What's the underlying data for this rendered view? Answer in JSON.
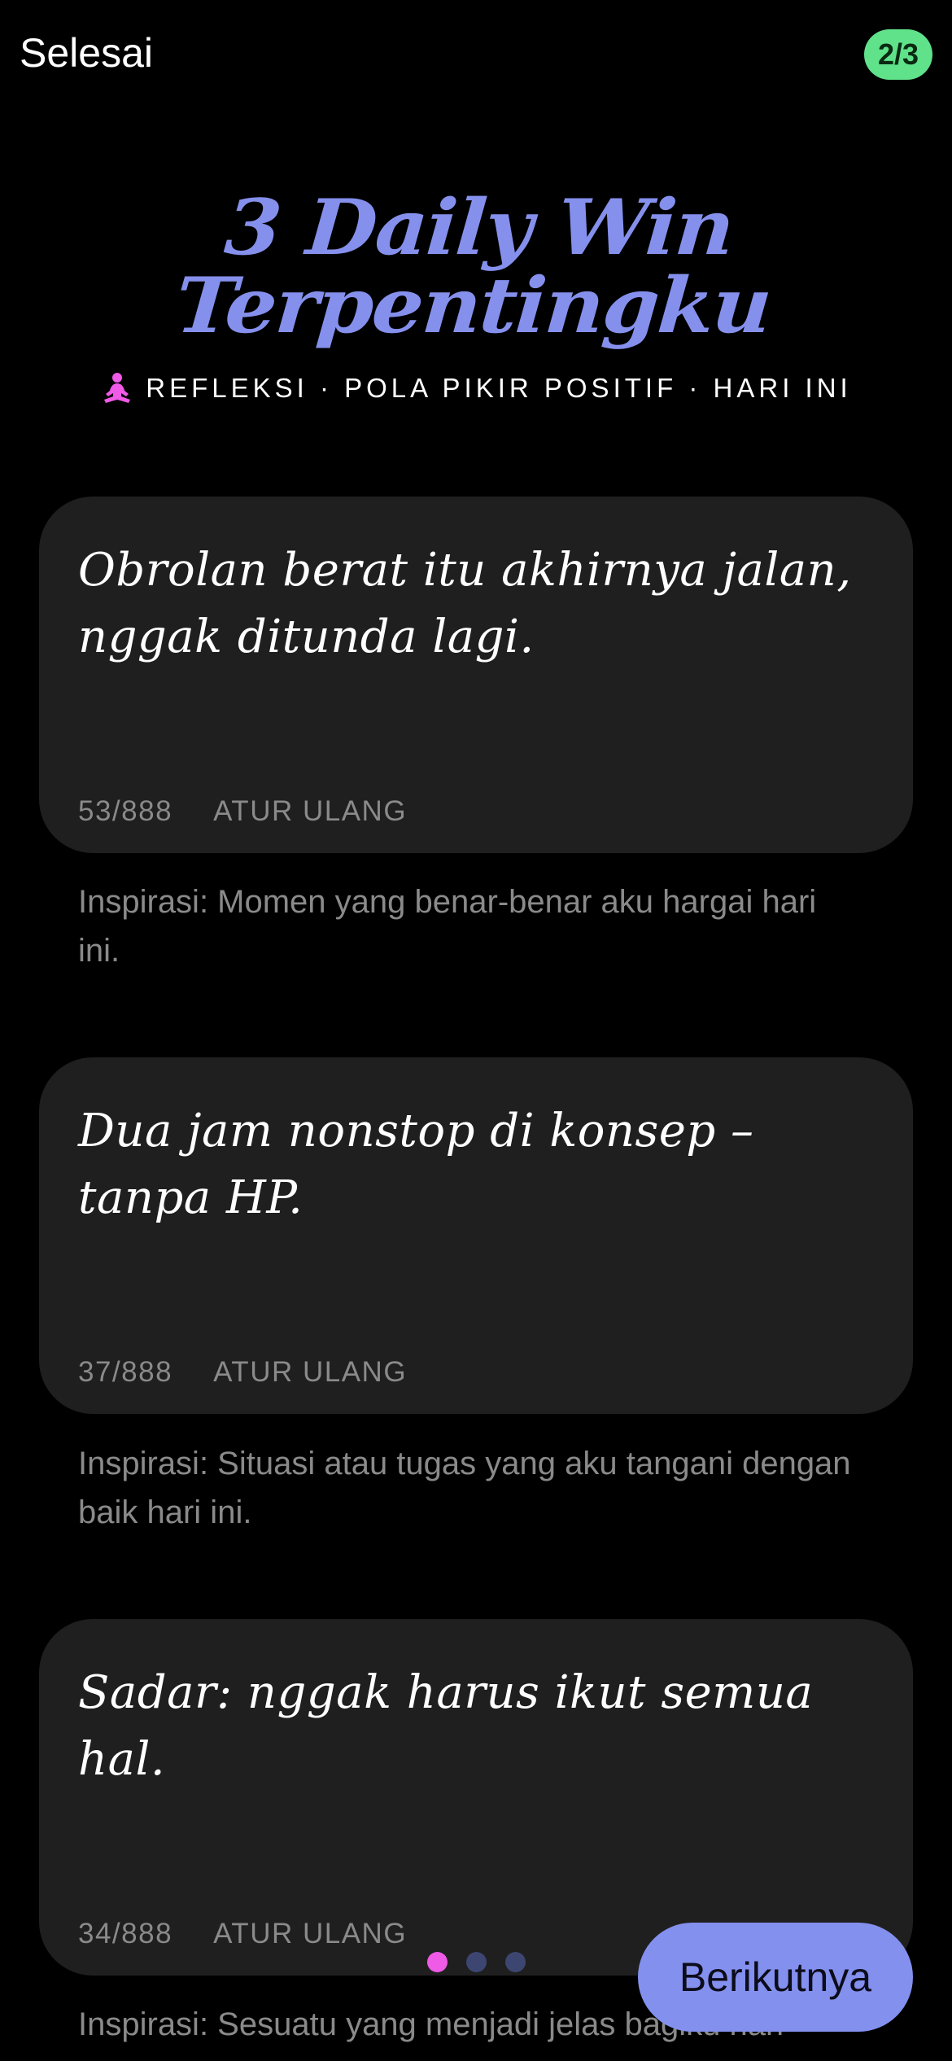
{
  "header": {
    "done_label": "Selesai",
    "step_indicator": "2/3"
  },
  "title": {
    "line1": "3 Daily Win",
    "line2": "Terpentingku"
  },
  "subtitle": {
    "icon": "meditation-icon",
    "text": "REFLEKSI · POLA PIKIR POSITIF · HARI INI"
  },
  "entries": [
    {
      "text": "Obrolan berat itu akhirnya jalan, nggak ditunda lagi.",
      "count": "53/888",
      "reset_label": "ATUR ULANG",
      "inspiration": "Inspirasi: Momen yang benar-benar aku hargai hari ini."
    },
    {
      "text": "Dua jam nonstop di konsep – tanpa HP.",
      "count": "37/888",
      "reset_label": "ATUR ULANG",
      "inspiration": "Inspirasi: Situasi atau tugas yang aku tangani dengan baik hari ini."
    },
    {
      "text": "Sadar: nggak harus ikut semua hal.",
      "count": "34/888",
      "reset_label": "ATUR ULANG",
      "inspiration": "Inspirasi: Sesuatu yang menjadi jelas bagiku hari"
    }
  ],
  "pagination": {
    "total": 3,
    "active_index": 0
  },
  "footer": {
    "next_label": "Berikutnya"
  },
  "colors": {
    "accent": "#8590ec",
    "badge": "#5fe28a",
    "dot_active": "#ef5ae6",
    "dot_inactive": "#3c4670",
    "card": "#1f1f1f"
  }
}
